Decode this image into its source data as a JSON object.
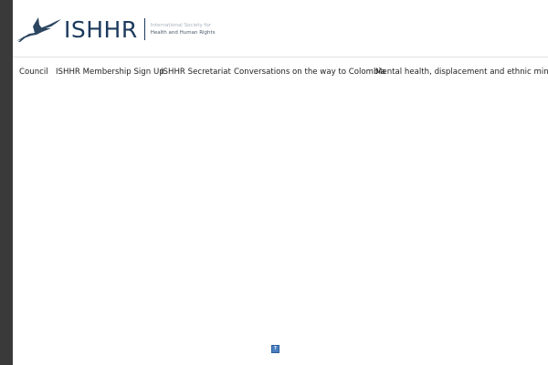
{
  "logo": {
    "wordmark": "ISHHR",
    "tagline_line1": "International Society for",
    "tagline_line2": "Health and Human Rights",
    "brand_color": "#1d3a5c",
    "icon": "heron-bird-icon"
  },
  "nav": {
    "items": [
      {
        "label": "Council"
      },
      {
        "label": "ISHHR Membership Sign Up"
      },
      {
        "label": "ISHHR Secretariat"
      },
      {
        "label": "Conversations on the way to Colombia"
      },
      {
        "label": "Mental health, displacement and ethnic minorities"
      }
    ]
  },
  "content": {
    "help_icon": "question-mark-icon",
    "help_glyph": "?"
  }
}
